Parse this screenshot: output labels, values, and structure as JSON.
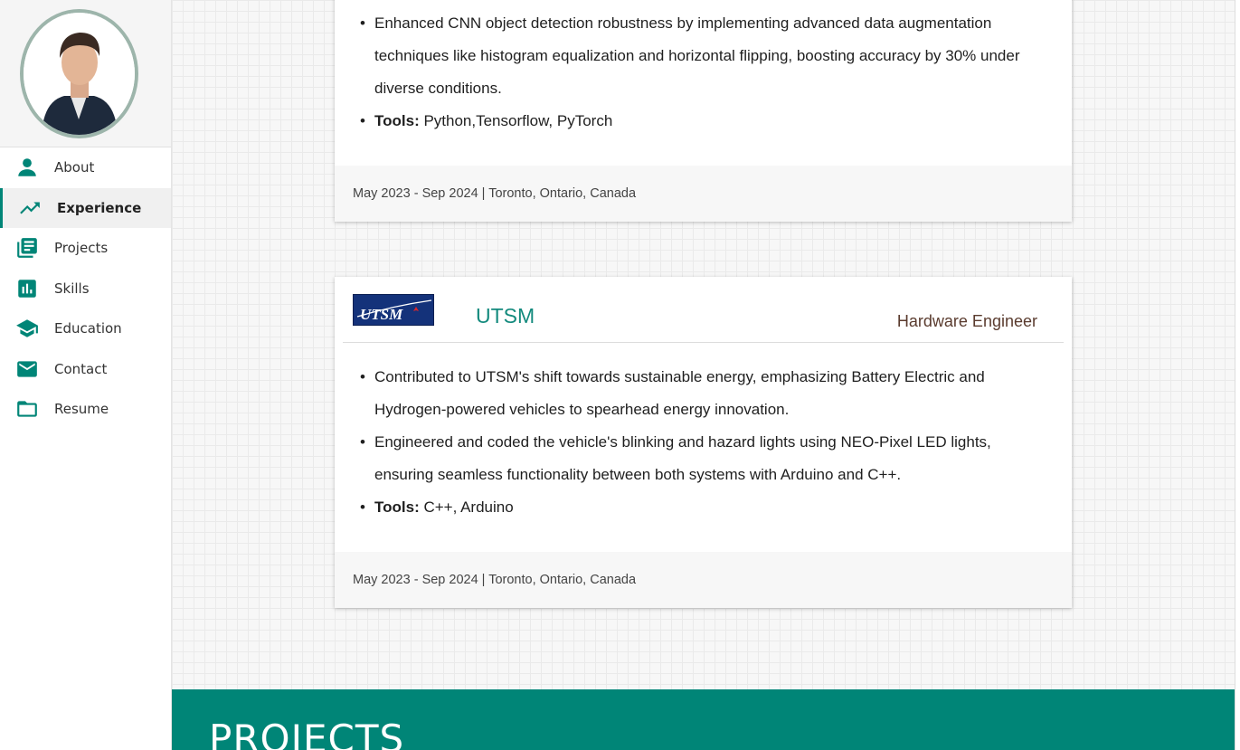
{
  "sidebar": {
    "items": [
      {
        "label": "About",
        "icon": "person-icon"
      },
      {
        "label": "Experience",
        "icon": "trending-up-icon"
      },
      {
        "label": "Projects",
        "icon": "library-books-icon"
      },
      {
        "label": "Skills",
        "icon": "bar-chart-icon"
      },
      {
        "label": "Education",
        "icon": "school-icon"
      },
      {
        "label": "Contact",
        "icon": "mail-icon"
      },
      {
        "label": "Resume",
        "icon": "folder-icon"
      }
    ],
    "active": "Experience",
    "accent": "#008577"
  },
  "experience": [
    {
      "bullets": [
        "Enhanced CNN object detection robustness by implementing advanced data augmentation techniques like histogram equalization and horizontal flipping, boosting accuracy by 30% under diverse conditions."
      ],
      "tools_label": "Tools:",
      "tools": " Python,Tensorflow, PyTorch",
      "footer": "May 2023 - Sep 2024 | Toronto, Ontario, Canada"
    },
    {
      "logo_text": "UTSM",
      "company": "UTSM",
      "role": "Hardware Engineer",
      "bullets": [
        "Contributed to UTSM's shift towards sustainable energy, emphasizing Battery Electric and Hydrogen-powered vehicles to spearhead energy innovation.",
        "Engineered and coded the vehicle's blinking and hazard lights using NEO-Pixel LED lights, ensuring seamless functionality between both systems with Arduino and C++."
      ],
      "tools_label": "Tools:",
      "tools": " C++, Arduino",
      "footer": "May 2023 - Sep 2024 | Toronto, Ontario, Canada"
    }
  ],
  "projects_section": {
    "title": "PROJECTS",
    "band_color": "#008577"
  }
}
